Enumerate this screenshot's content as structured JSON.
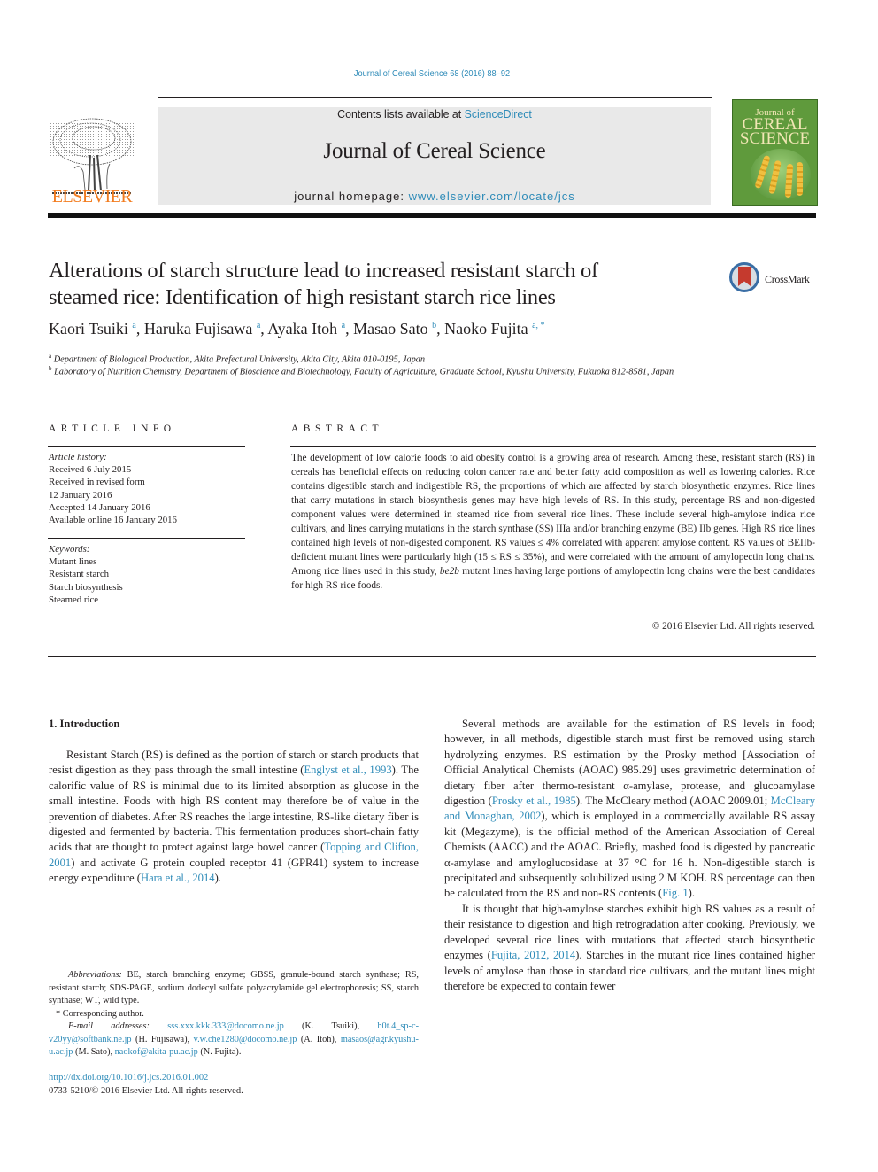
{
  "header": {
    "running_head": "Journal of Cereal Science 68 (2016) 88–92",
    "contents_prefix": "Contents lists available at ",
    "contents_link": "ScienceDirect",
    "journal_name": "Journal of Cereal Science",
    "homepage_prefix": "journal homepage: ",
    "homepage_link": "www.elsevier.com/locate/jcs",
    "publisher_wordmark": "ELSEVIER",
    "cover": {
      "line1": "Journal of",
      "line2": "CEREAL",
      "line3": "SCIENCE"
    },
    "colors": {
      "link": "#2e8bb8",
      "elsevier_orange": "#f27c1f",
      "masthead_bg": "#e9e9e9",
      "cover_green": "#5f9a3c"
    }
  },
  "article": {
    "title_line1": "Alterations of starch structure lead to increased resistant starch of",
    "title_line2": "steamed rice: Identification of high resistant starch rice lines",
    "crossmark_label": "CrossMark",
    "authors": [
      {
        "name": "Kaori Tsuiki",
        "sup": "a"
      },
      {
        "name": "Haruka Fujisawa",
        "sup": "a"
      },
      {
        "name": "Ayaka Itoh",
        "sup": "a"
      },
      {
        "name": "Masao Sato",
        "sup": "b"
      },
      {
        "name": "Naoko Fujita",
        "sup": "a, *"
      }
    ],
    "affiliations": [
      {
        "sup": "a",
        "text": "Department of Biological Production, Akita Prefectural University, Akita City, Akita 010-0195, Japan"
      },
      {
        "sup": "b",
        "text": "Laboratory of Nutrition Chemistry, Department of Bioscience and Biotechnology, Faculty of Agriculture, Graduate School, Kyushu University, Fukuoka 812-8581, Japan"
      }
    ]
  },
  "article_info": {
    "heading": "ARTICLE INFO",
    "history_label": "Article history:",
    "history": [
      "Received 6 July 2015",
      "Received in revised form",
      "12 January 2016",
      "Accepted 14 January 2016",
      "Available online 16 January 2016"
    ],
    "keywords_label": "Keywords:",
    "keywords": [
      "Mutant lines",
      "Resistant starch",
      "Starch biosynthesis",
      "Steamed rice"
    ]
  },
  "abstract": {
    "heading": "ABSTRACT",
    "text_part1": "The development of low calorie foods to aid obesity control is a growing area of research. Among these, resistant starch (RS) in cereals has beneficial effects on reducing colon cancer rate and better fatty acid composition as well as lowering calories. Rice contains digestible starch and indigestible RS, the proportions of which are affected by starch biosynthetic enzymes. Rice lines that carry mutations in starch biosynthesis genes may have high levels of RS. In this study, percentage RS and non-digested component values were determined in steamed rice from several rice lines. These include several high-amylose indica rice cultivars, and lines carrying mutations in the starch synthase (SS) IIIa and/or branching enzyme (BE) IIb genes. High RS rice lines contained high levels of non-digested component. RS values ≤ 4% correlated with apparent amylose content. RS values of BEIIb-deficient mutant lines were particularly high (15 ≤ RS ≤ 35%), and were correlated with the amount of amylopectin long chains. Among rice lines used in this study, ",
    "text_italic": "be2b",
    "text_part2": " mutant lines having large portions of amylopectin long chains were the best candidates for high RS rice foods.",
    "copyright": "© 2016 Elsevier Ltd. All rights reserved."
  },
  "body": {
    "intro_heading": "1.  Introduction",
    "left_p1": [
      {
        "t": "Resistant Starch (RS) is defined as the portion of starch or starch products that resist digestion as they pass through the small intestine ("
      },
      {
        "l": "Englyst et al., 1993"
      },
      {
        "t": "). The calorific value of RS is minimal due to its limited absorption as glucose in the small intestine. Foods with high RS content may therefore be of value in the prevention of diabetes. After RS reaches the large intestine, RS-like dietary fiber is digested and fermented by bacteria. This fermentation produces short-chain fatty acids that are thought to protect against large bowel cancer ("
      },
      {
        "l": "Topping and Clifton, 2001"
      },
      {
        "t": ") and activate G protein coupled receptor 41 (GPR41) system to increase energy expenditure ("
      },
      {
        "l": "Hara et al., 2014"
      },
      {
        "t": ")."
      }
    ],
    "right_p1": [
      {
        "t": "Several methods are available for the estimation of RS levels in food; however, in all methods, digestible starch must first be removed using starch hydrolyzing enzymes. RS estimation by the Prosky method [Association of Official Analytical Chemists (AOAC) 985.29] uses gravimetric determination of dietary fiber after thermo-resistant α-amylase, protease, and glucoamylase digestion ("
      },
      {
        "l": "Prosky et al., 1985"
      },
      {
        "t": "). The McCleary method (AOAC 2009.01; "
      },
      {
        "l": "McCleary and Monaghan, 2002"
      },
      {
        "t": "), which is employed in a commercially available RS assay kit (Megazyme), is the official method of the American Association of Cereal Chemists (AACC) and the AOAC. Briefly, mashed food is digested by pancreatic α-amylase and amyloglucosidase at 37 °C for 16 h. Non-digestible starch is precipitated and subsequently solubilized using 2 M KOH. RS percentage can then be calculated from the RS and non-RS contents ("
      },
      {
        "l": "Fig. 1"
      },
      {
        "t": ")."
      }
    ],
    "right_p2": [
      {
        "t": "It is thought that high-amylose starches exhibit high RS values as a result of their resistance to digestion and high retrogradation after cooking. Previously, we developed several rice lines with mutations that affected starch biosynthetic enzymes ("
      },
      {
        "l": "Fujita, 2012, 2014"
      },
      {
        "t": "). Starches in the mutant rice lines contained higher levels of amylose than those in standard rice cultivars, and the mutant lines might therefore be expected to contain fewer"
      }
    ]
  },
  "footnotes": {
    "abbrev_label": "Abbreviations:",
    "abbrev_text": " BE, starch branching enzyme; GBSS, granule-bound starch synthase; RS, resistant starch; SDS-PAGE, sodium dodecyl sulfate polyacrylamide gel electrophoresis; SS, starch synthase; WT, wild type.",
    "corresponding": "* Corresponding author.",
    "email_label": "E-mail addresses:",
    "emails": [
      {
        "addr": "sss.xxx.kkk.333@docomo.ne.jp",
        "who": " (K. Tsuiki), "
      },
      {
        "addr": "h0t.4_sp-c-v20yy@softbank.ne.jp",
        "who": " (H. Fujisawa), "
      },
      {
        "addr": "v.w.che1280@docomo.ne.jp",
        "who": " (A. Itoh), "
      },
      {
        "addr": "masaos@agr.kyushu-u.ac.jp",
        "who": " (M. Sato), "
      },
      {
        "addr": "naokof@akita-pu.ac.jp",
        "who": " (N. Fujita)."
      }
    ],
    "doi": "http://dx.doi.org/10.1016/j.jcs.2016.01.002",
    "issn": "0733-5210/© 2016 Elsevier Ltd. All rights reserved."
  }
}
